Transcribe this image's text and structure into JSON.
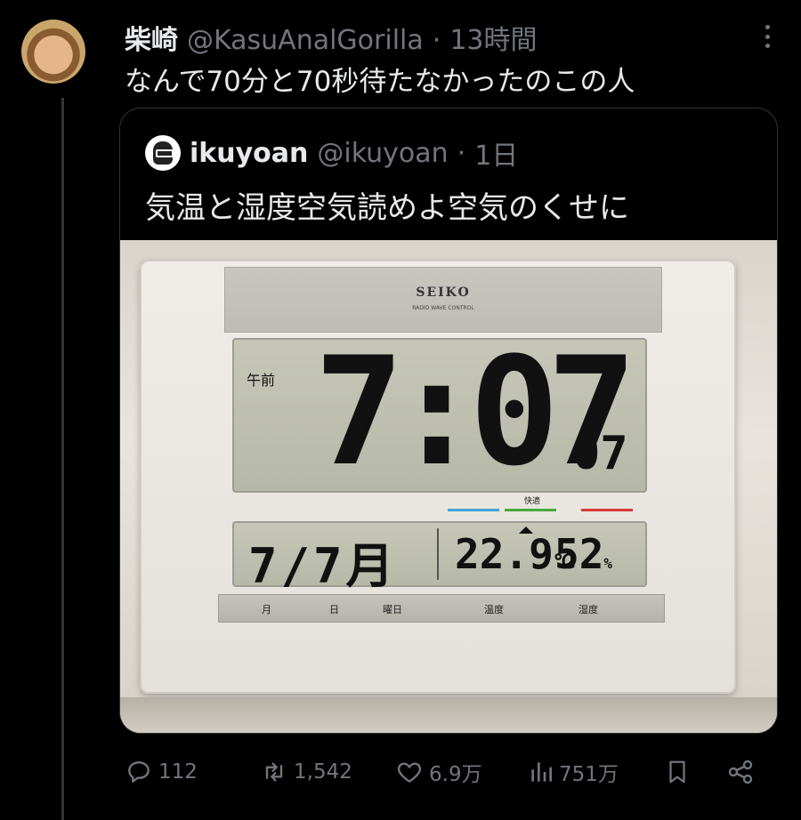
{
  "post": {
    "display_name": "柴崎",
    "handle": "@KasuAnalGorilla",
    "separator": "·",
    "time": "13時間",
    "text": "なんで70分と70秒待たなかったのこの人"
  },
  "quoted": {
    "display_name": "ikuyoan",
    "handle": "@ikuyoan",
    "separator": "·",
    "time": "1日",
    "text": "気温と湿度空気読めよ空気のくせに",
    "photo": {
      "brand": "SEIKO",
      "brand_sub": "RADIO WAVE CONTROL",
      "ampm": "午前",
      "time": "7:07",
      "seconds": "07",
      "comfort_label": "快適",
      "date": "7/7月",
      "temperature": "22.9",
      "temperature_unit": "℃",
      "humidity": "52",
      "humidity_unit": "%",
      "labels": [
        "月",
        "日",
        "曜日",
        "温度",
        "湿度"
      ]
    }
  },
  "actions": {
    "replies": "112",
    "reposts": "1,542",
    "likes": "6.9万",
    "views": "751万"
  }
}
